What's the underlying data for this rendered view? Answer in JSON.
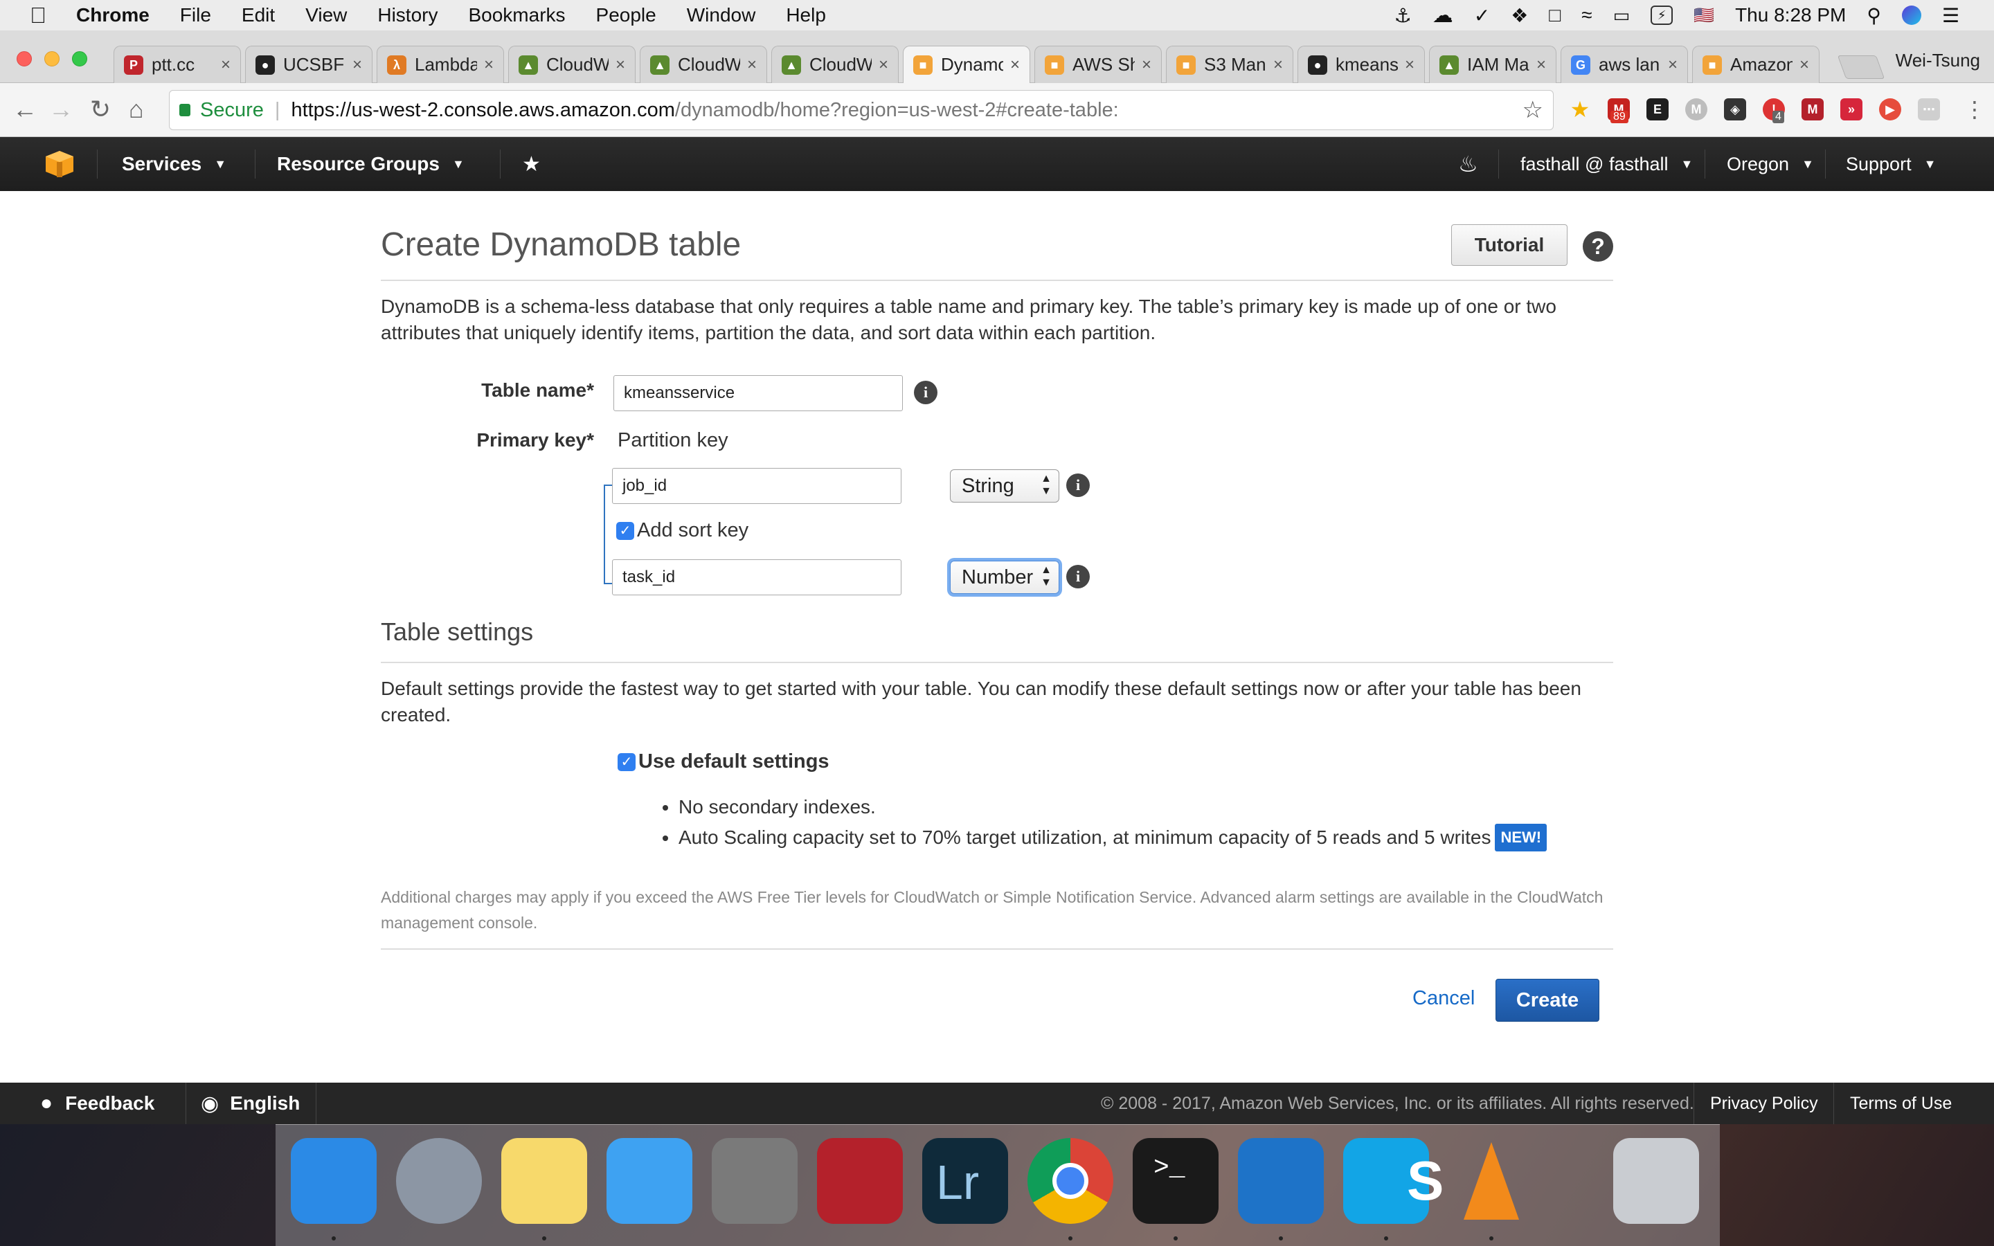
{
  "menubar": {
    "app_name": "Chrome",
    "items": [
      "File",
      "Edit",
      "View",
      "History",
      "Bookmarks",
      "People",
      "Window",
      "Help"
    ],
    "clock": "Thu 8:28 PM",
    "flag": "🇺🇸"
  },
  "browser": {
    "tabs": [
      {
        "label": "ptt.cc",
        "icon": "P",
        "color": "#c0262d"
      },
      {
        "label": "UCSBF…",
        "icon": "●",
        "color": "#222222"
      },
      {
        "label": "Lambda",
        "icon": "λ",
        "color": "#e07a24"
      },
      {
        "label": "CloudW",
        "icon": "▲",
        "color": "#5b8a2f"
      },
      {
        "label": "CloudW",
        "icon": "▲",
        "color": "#5b8a2f"
      },
      {
        "label": "CloudW",
        "icon": "▲",
        "color": "#5b8a2f"
      },
      {
        "label": "Dynamo",
        "icon": "■",
        "color": "#f2a43a"
      },
      {
        "label": "AWS Sh",
        "icon": "■",
        "color": "#f2a43a"
      },
      {
        "label": "S3 Man",
        "icon": "■",
        "color": "#f2a43a"
      },
      {
        "label": "kmeans",
        "icon": "●",
        "color": "#222222"
      },
      {
        "label": "IAM Ma",
        "icon": "▲",
        "color": "#5b8a2f"
      },
      {
        "label": "aws lan",
        "icon": "G",
        "color": "#4285f4"
      },
      {
        "label": "Amazon",
        "icon": "■",
        "color": "#f2a43a"
      }
    ],
    "active_tab_index": 6,
    "profile_name": "Wei-Tsung",
    "secure_label": "Secure",
    "url_host": "https://us-west-2.console.aws.amazon.com",
    "url_path": "/dynamodb/home?region=us-west-2#create-table:",
    "extension_badges": {
      "gmail": "89",
      "count": "4"
    }
  },
  "aws_nav": {
    "services": "Services",
    "resource_groups": "Resource Groups",
    "account": "fasthall @ fasthall",
    "region": "Oregon",
    "support": "Support"
  },
  "page": {
    "title": "Create DynamoDB table",
    "tutorial_button": "Tutorial",
    "help_icon": "?",
    "intro": "DynamoDB is a schema-less database that only requires a table name and primary key. The table’s primary key is made up of one or two attributes that uniquely identify items, partition the data, and sort data within each partition.",
    "table_name_label": "Table name*",
    "table_name_value": "kmeansservice",
    "primary_key_label": "Primary key*",
    "partition_key_label": "Partition key",
    "partition_key_value": "job_id",
    "partition_key_type": "String",
    "add_sort_key_label": "Add sort key",
    "add_sort_key_checked": true,
    "sort_key_value": "task_id",
    "sort_key_type": "Number",
    "table_settings_heading": "Table settings",
    "settings_intro": "Default settings provide the fastest way to get started with your table. You can modify these default settings now or after your table has been created.",
    "use_default_label": "Use default settings",
    "use_default_checked": true,
    "bullet_1": "No secondary indexes.",
    "bullet_2": "Auto Scaling capacity set to 70% target utilization, at minimum capacity of 5 reads and 5 writes",
    "new_badge": "NEW!",
    "charges_note": "Additional charges may apply if you exceed the AWS Free Tier levels for CloudWatch or Simple Notification Service. Advanced alarm settings are available in the CloudWatch management console.",
    "cancel": "Cancel",
    "create": "Create"
  },
  "footer": {
    "feedback": "Feedback",
    "language": "English",
    "copyright": "© 2008 - 2017, Amazon Web Services, Inc. or its affiliates. All rights reserved.",
    "privacy": "Privacy Policy",
    "terms": "Terms of Use"
  },
  "dock": {
    "apps": [
      {
        "name": "finder-icon",
        "color": "#2b8ae6"
      },
      {
        "name": "launchpad-icon",
        "color": "#8c96a4"
      },
      {
        "name": "notes-icon",
        "color": "#f7d96b"
      },
      {
        "name": "messages-icon",
        "color": "#3ea2f2"
      },
      {
        "name": "system-preferences-icon",
        "color": "#7a7a7a"
      },
      {
        "name": "mendeley-icon",
        "color": "#b4212b"
      },
      {
        "name": "lightroom-icon",
        "color": "#0f2a3a"
      },
      {
        "name": "chrome-icon",
        "color": "#e8e8e8"
      },
      {
        "name": "terminal-icon",
        "color": "#1a1a1a"
      },
      {
        "name": "vscode-icon",
        "color": "#1e73c8"
      },
      {
        "name": "skype-icon",
        "color": "#12a5e6"
      },
      {
        "name": "vlc-icon",
        "color": "#f28a1b"
      },
      {
        "name": "trash-icon",
        "color": "#c9ccd1"
      }
    ],
    "lightroom_text": "Lr",
    "terminal_text": ">_",
    "skype_text": "S"
  }
}
